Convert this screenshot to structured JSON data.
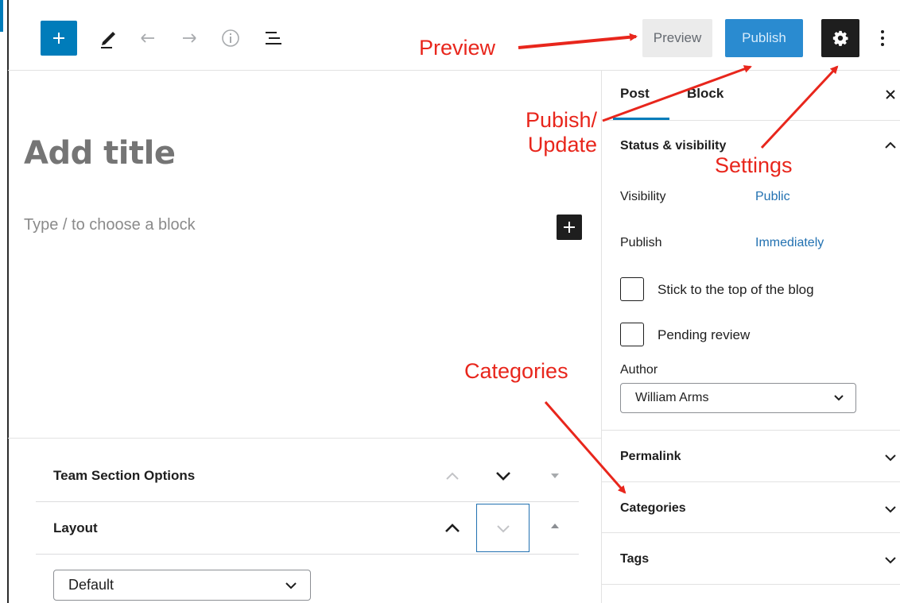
{
  "toolbar": {
    "preview_label": "Preview",
    "publish_label": "Publish",
    "icons": [
      "plus-icon",
      "pencil-icon",
      "undo-icon",
      "redo-icon",
      "info-icon",
      "list-view-icon",
      "gear-icon",
      "more-vertical-icon"
    ]
  },
  "editor": {
    "title_placeholder": "Add title",
    "block_placeholder": "Type / to choose a block"
  },
  "meta_boxes": {
    "team_section_title": "Team Section Options",
    "layout_title": "Layout",
    "layout_select_value": "Default"
  },
  "sidebar": {
    "tabs": [
      {
        "label": "Post",
        "active": true
      },
      {
        "label": "Block",
        "active": false
      }
    ],
    "status_panel": {
      "title": "Status & visibility",
      "visibility_label": "Visibility",
      "visibility_value": "Public",
      "publish_label": "Publish",
      "publish_value": "Immediately",
      "sticky_label": "Stick to the top of the blog",
      "pending_label": "Pending review",
      "author_label": "Author",
      "author_value": "William Arms"
    },
    "panels": [
      "Permalink",
      "Categories",
      "Tags"
    ]
  },
  "annotations": {
    "preview": "Preview",
    "publish_update_line1": "Pubish/",
    "publish_update_line2": "Update",
    "settings": "Settings",
    "categories": "Categories"
  },
  "colors": {
    "accent": "#007cba",
    "annotation": "#e8261c"
  }
}
